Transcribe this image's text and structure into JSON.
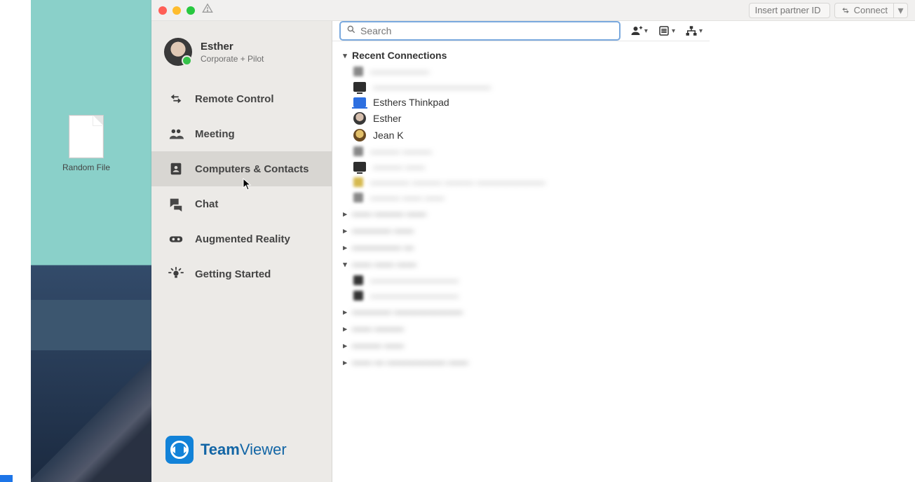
{
  "desktop": {
    "file_label": "Random File"
  },
  "titlebar": {
    "partner_id_placeholder": "Insert partner ID",
    "connect_label": "Connect"
  },
  "profile": {
    "name": "Esther",
    "subtitle": "Corporate + Pilot"
  },
  "nav": {
    "remote_control": "Remote Control",
    "meeting": "Meeting",
    "computers_contacts": "Computers & Contacts",
    "chat": "Chat",
    "augmented_reality": "Augmented Reality",
    "getting_started": "Getting Started",
    "active": "computers_contacts"
  },
  "brand": {
    "name_a": "Team",
    "name_b": "Viewer"
  },
  "search": {
    "placeholder": "Search"
  },
  "groups": {
    "recent_label": "Recent Connections",
    "recent": [
      {
        "kind": "blur",
        "label": "——————"
      },
      {
        "kind": "monitor",
        "label": "————————————",
        "blur": true
      },
      {
        "kind": "laptop",
        "label": "Esthers Thinkpad"
      },
      {
        "kind": "avatar",
        "label": "Esther"
      },
      {
        "kind": "avatar-alt",
        "label": "Jean K"
      },
      {
        "kind": "blur",
        "label": "——— ———"
      },
      {
        "kind": "monitor",
        "label": "——— ——",
        "blur": true
      },
      {
        "kind": "blur-y",
        "label": "———— ——— ——— ———————"
      },
      {
        "kind": "blur",
        "label": "——— —— ——"
      }
    ],
    "collapsed": [
      "—— ——— ——",
      "———— ——",
      "————— —",
      "———— ———————",
      "—— ———",
      "——— ——",
      "—— — ——————  ——"
    ],
    "expanded2_label": "—— —— ——",
    "expanded2": [
      "—————————",
      "—————————"
    ]
  }
}
